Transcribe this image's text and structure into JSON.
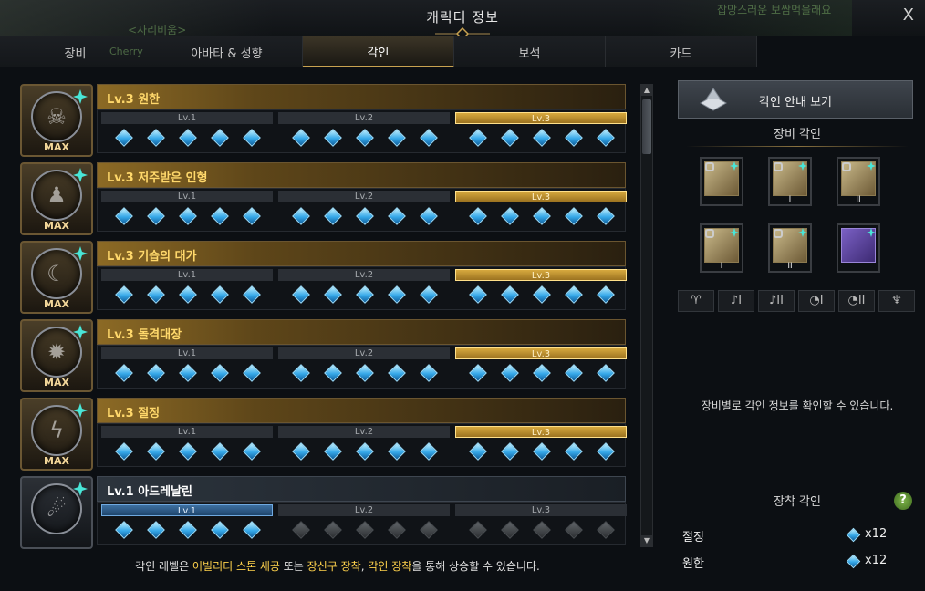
{
  "window": {
    "title": "캐릭터 정보",
    "close_label": "X",
    "bg_text_left": "<자리비움>",
    "bg_text_name": "Cherry",
    "bg_text_right": "잡망스러운 보쌈먹을래요"
  },
  "tabs": [
    {
      "label": "장비",
      "active": false
    },
    {
      "label": "아바타 & 성향",
      "active": false
    },
    {
      "label": "각인",
      "active": true
    },
    {
      "label": "보석",
      "active": false
    },
    {
      "label": "카드",
      "active": false
    }
  ],
  "engravings": [
    {
      "name": "Lv.3 원한",
      "max_label": "MAX",
      "icon": "grudge-icon",
      "levels": [
        {
          "label": "Lv.1",
          "state": "normal",
          "gems_lit": 5
        },
        {
          "label": "Lv.2",
          "state": "normal",
          "gems_lit": 5
        },
        {
          "label": "Lv.3",
          "state": "gold",
          "gems_lit": 5
        }
      ]
    },
    {
      "name": "Lv.3 저주받은 인형",
      "max_label": "MAX",
      "icon": "cursed-doll-icon",
      "levels": [
        {
          "label": "Lv.1",
          "state": "normal",
          "gems_lit": 5
        },
        {
          "label": "Lv.2",
          "state": "normal",
          "gems_lit": 5
        },
        {
          "label": "Lv.3",
          "state": "gold",
          "gems_lit": 5
        }
      ]
    },
    {
      "name": "Lv.3 기습의 대가",
      "max_label": "MAX",
      "icon": "master-ambusher-icon",
      "levels": [
        {
          "label": "Lv.1",
          "state": "normal",
          "gems_lit": 5
        },
        {
          "label": "Lv.2",
          "state": "normal",
          "gems_lit": 5
        },
        {
          "label": "Lv.3",
          "state": "gold",
          "gems_lit": 5
        }
      ]
    },
    {
      "name": "Lv.3 돌격대장",
      "max_label": "MAX",
      "icon": "raid-captain-icon",
      "levels": [
        {
          "label": "Lv.1",
          "state": "normal",
          "gems_lit": 5
        },
        {
          "label": "Lv.2",
          "state": "normal",
          "gems_lit": 5
        },
        {
          "label": "Lv.3",
          "state": "gold",
          "gems_lit": 5
        }
      ]
    },
    {
      "name": "Lv.3 절정",
      "max_label": "MAX",
      "icon": "climax-icon",
      "levels": [
        {
          "label": "Lv.1",
          "state": "normal",
          "gems_lit": 5
        },
        {
          "label": "Lv.2",
          "state": "normal",
          "gems_lit": 5
        },
        {
          "label": "Lv.3",
          "state": "gold",
          "gems_lit": 5
        }
      ]
    },
    {
      "name": "Lv.1 아드레날린",
      "max_label": "",
      "icon": "adrenaline-icon",
      "levels": [
        {
          "label": "Lv.1",
          "state": "blue",
          "gems_lit": 5
        },
        {
          "label": "Lv.2",
          "state": "normal",
          "gems_lit": 0
        },
        {
          "label": "Lv.3",
          "state": "normal",
          "gems_lit": 0
        }
      ]
    }
  ],
  "footer": {
    "part1": "각인 레벨은 ",
    "hl1": "어빌리티 스톤 세공",
    "part2": " 또는 ",
    "hl2": "장신구 장착",
    "part3": ", ",
    "hl3": "각인 장착",
    "part4": "을 통해 상승할 수 있습니다."
  },
  "right_panel": {
    "guide_button": "각인 안내 보기",
    "equipment_title": "장비 각인",
    "equipment_slots": [
      {
        "icon": "necklace-icon",
        "roman": "",
        "color": "gold"
      },
      {
        "icon": "earring-icon",
        "roman": "I",
        "color": "gold"
      },
      {
        "icon": "earring-icon",
        "roman": "II",
        "color": "gold"
      },
      {
        "icon": "ring-icon",
        "roman": "I",
        "color": "gold"
      },
      {
        "icon": "ring-icon",
        "roman": "II",
        "color": "gold"
      },
      {
        "icon": "ability-stone-icon",
        "roman": "",
        "color": "purple"
      }
    ],
    "slot_buttons": [
      "♈",
      "♪I",
      "♪II",
      "◔I",
      "◔II",
      "♆"
    ],
    "info_text": "장비별로 각인 정보를 확인할 수 있습니다.",
    "equipped_title": "장착 각인",
    "help_label": "?",
    "equipped": [
      {
        "name": "절정",
        "count": "x12"
      },
      {
        "name": "원한",
        "count": "x12"
      }
    ]
  },
  "colors": {
    "accent_gold": "#c9a250",
    "gem_blue": "#36a8e8",
    "highlight": "#ffd24c"
  }
}
